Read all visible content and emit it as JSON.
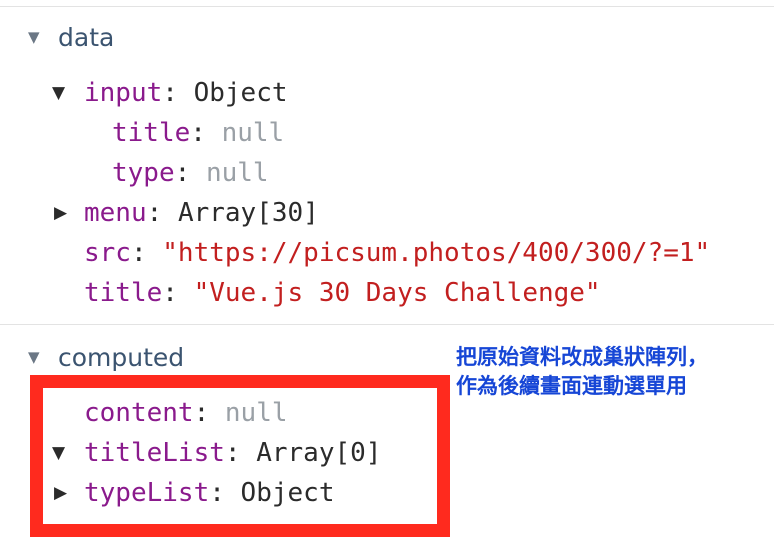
{
  "data_section": {
    "header": "data",
    "rows": {
      "input": {
        "key": "input",
        "value": "Object"
      },
      "input_title": {
        "key": "title",
        "value": "null"
      },
      "input_type": {
        "key": "type",
        "value": "null"
      },
      "menu": {
        "key": "menu",
        "value": "Array[30]"
      },
      "src": {
        "key": "src",
        "value": "\"https://picsum.photos/400/300/?=1\""
      },
      "title": {
        "key": "title",
        "value": "\"Vue.js 30 Days Challenge\""
      }
    }
  },
  "computed_section": {
    "header": "computed",
    "rows": {
      "content": {
        "key": "content",
        "value": "null"
      },
      "titleList": {
        "key": "titleList",
        "value": "Array[0]"
      },
      "typeList": {
        "key": "typeList",
        "value": "Object"
      }
    }
  },
  "annotation": {
    "line1": "把原始資料改成巢狀陣列，",
    "line2": "作為後續畫面連動選單用",
    "color": "#1646d6"
  },
  "highlight_color": "#ff2a1e",
  "icons": {
    "expanded": "triangle-down-icon",
    "collapsed": "triangle-right-icon"
  }
}
